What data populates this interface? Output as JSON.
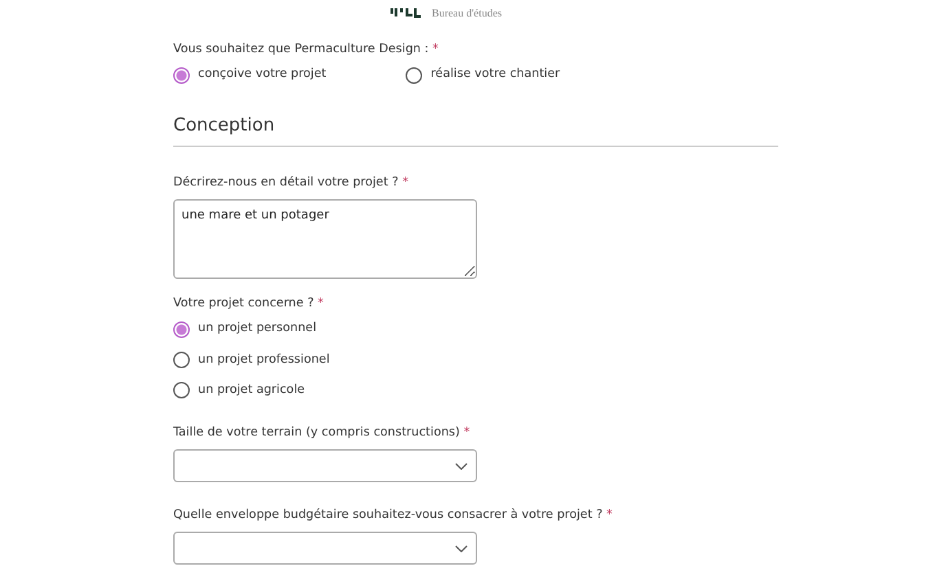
{
  "header": {
    "subtitle": "Bureau d'études"
  },
  "items": [
    {
      "kind": "radiorow",
      "label": "Vous souhaitez que Permaculture Design :",
      "mark": "*",
      "options": [
        {
          "label": "conçoive votre projet",
          "selected": true
        },
        {
          "label": "réalise votre chantier",
          "selected": false
        }
      ]
    },
    {
      "kind": "heading",
      "label": "Conception"
    },
    {
      "kind": "textarea",
      "label": "Décrirez-nous en détail votre projet ?",
      "mark": "*",
      "value": "une mare et un potager"
    },
    {
      "kind": "radiolist",
      "label": "Votre projet concerne ?",
      "mark": "*",
      "options": [
        {
          "label": "un projet personnel",
          "selected": true
        },
        {
          "label": "un projet professionel",
          "selected": false
        },
        {
          "label": "un projet agricole",
          "selected": false
        }
      ]
    },
    {
      "kind": "select",
      "label": "Taille de votre terrain (y compris constructions)",
      "mark": "*"
    },
    {
      "kind": "select",
      "label": "Quelle enveloppe budgétaire souhaitez-vous consacrer à votre projet ?",
      "mark": "*"
    }
  ]
}
